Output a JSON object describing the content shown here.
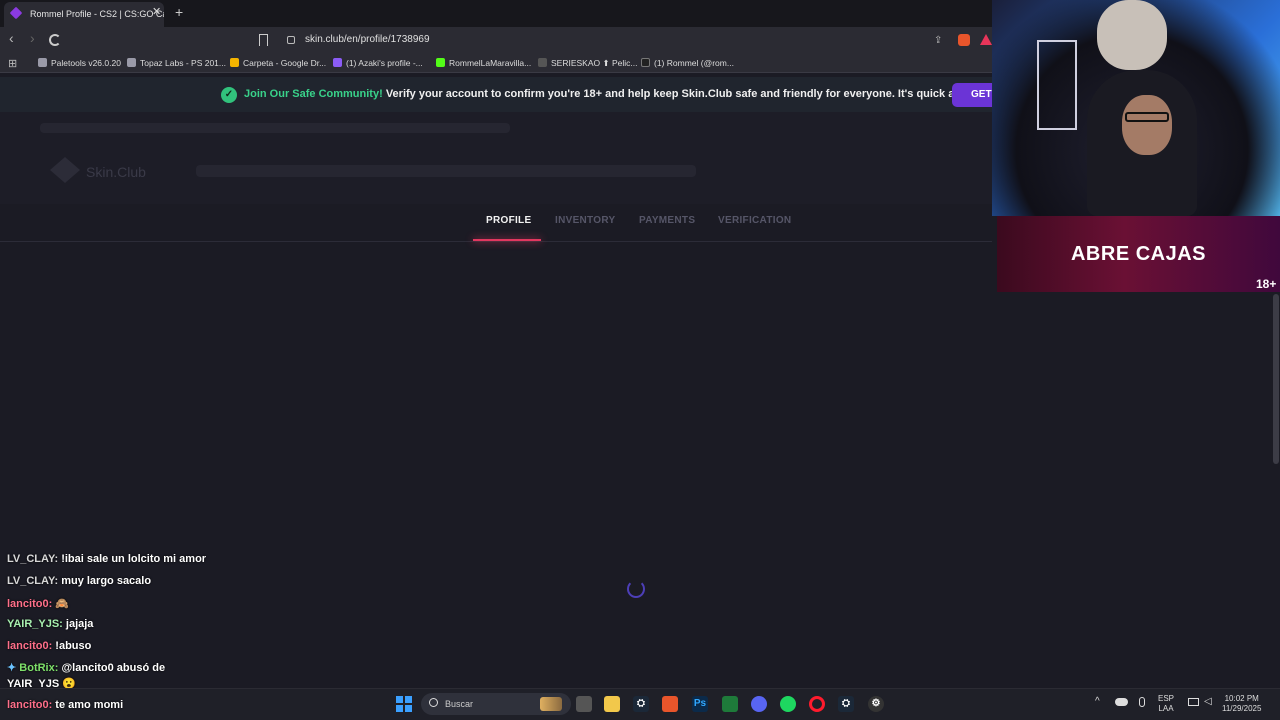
{
  "browser": {
    "tab_title": "Rommel Profile - CS2 | CS:GO Ca",
    "url": "skin.club/en/profile/1738969",
    "bookmarks": [
      {
        "label": "Paletools v26.0.20",
        "color": "#9a9aa8"
      },
      {
        "label": "Topaz Labs - PS 201...",
        "color": "#9a9aa8"
      },
      {
        "label": "Carpeta - Google Dr...",
        "color": "#f4b400"
      },
      {
        "label": "(1) Azaki's profile -...",
        "color": "#8b5cf6"
      },
      {
        "label": "RommelLaMaravilla...",
        "color": "#53fc18"
      },
      {
        "label": "SERIESKAO ⬆ Pelic...",
        "color": "#555"
      },
      {
        "label": "(1) Rommel (@rom...",
        "color": "#222"
      }
    ]
  },
  "banner": {
    "strong": "Join Our Safe Community!",
    "text": "Verify your account to confirm you're 18+ and help keep Skin.Club safe and friendly for everyone. It's quick and easy.",
    "button": "GET"
  },
  "site": {
    "brand": "Skin.Club",
    "tabs": [
      "PROFILE",
      "INVENTORY",
      "PAYMENTS",
      "VERIFICATION"
    ],
    "active_tab": "PROFILE"
  },
  "overlay": {
    "title": "ABRE CAJAS",
    "age": "18+"
  },
  "chat": [
    {
      "user": "LV_CLAY:",
      "msg": "!ibai sale un lolcito mi amor"
    },
    {
      "user": "LV_CLAY:",
      "msg": "muy largo sacalo"
    },
    {
      "user": "lancito0:",
      "msg": "🙈"
    },
    {
      "user": "YAIR_YJS:",
      "msg": "jajaja"
    },
    {
      "user": "lancito0:",
      "msg": "!abuso"
    },
    {
      "user": "BotRix:",
      "msg": "@lancito0 abusó de"
    },
    {
      "user": "",
      "msg": "YAIR_YJS 😮"
    },
    {
      "user": "lancito0:",
      "msg": "te amo momi"
    }
  ],
  "taskbar": {
    "search": "Buscar",
    "lang1": "ESP",
    "lang2": "LAA",
    "time": "10:02 PM",
    "date": "11/29/2025"
  }
}
